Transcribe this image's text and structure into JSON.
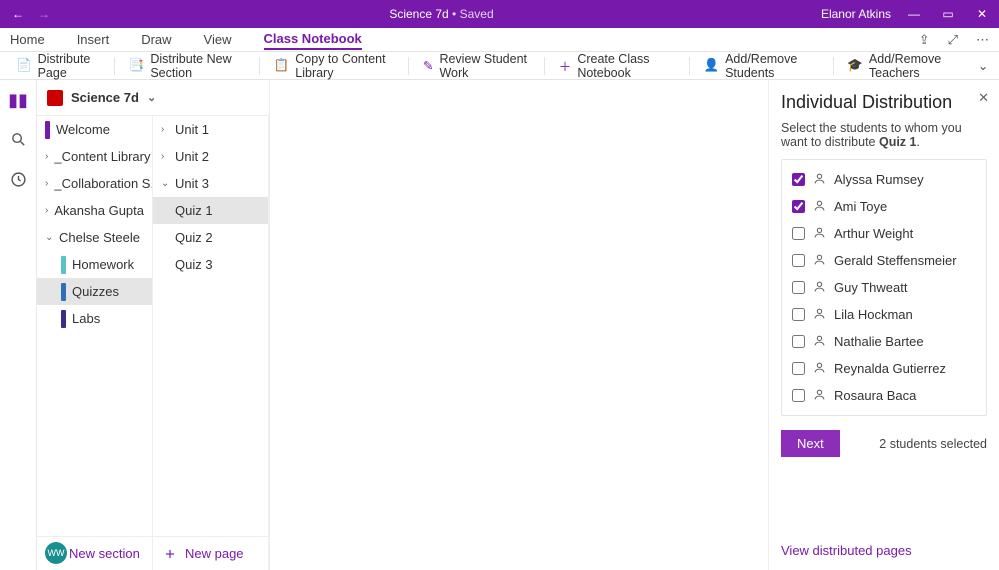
{
  "title": {
    "name": "Science 7d",
    "status": "Saved",
    "user": "Elanor Atkins"
  },
  "menu": {
    "tabs": [
      "Home",
      "Insert",
      "Draw",
      "View",
      "Class Notebook"
    ],
    "active": 4
  },
  "toolbar": [
    "Distribute Page",
    "Distribute New Section",
    "Copy to Content Library",
    "Review Student Work",
    "Create Class Notebook",
    "Add/Remove Students",
    "Add/Remove Teachers"
  ],
  "notebook": "Science 7d",
  "sections": [
    {
      "label": "Welcome",
      "bar": "#7719aa",
      "chev": ""
    },
    {
      "label": "_Content Library",
      "chev": "›"
    },
    {
      "label": "_Collaboration S...",
      "chev": "›"
    },
    {
      "label": "Akansha Gupta",
      "chev": "›"
    },
    {
      "label": "Chelse Steele",
      "chev": "⌄",
      "expanded": true
    },
    {
      "label": "Homework",
      "bar": "#59c2c9",
      "indent": true
    },
    {
      "label": "Quizzes",
      "bar": "#2e6fb5",
      "indent": true,
      "selected": true
    },
    {
      "label": "Labs",
      "bar": "#3b2e87",
      "indent": true
    }
  ],
  "pages_header": [
    {
      "label": "Unit 1",
      "chev": "›"
    },
    {
      "label": "Unit 2",
      "chev": "›"
    },
    {
      "label": "Unit 3",
      "chev": "⌄"
    }
  ],
  "pages": [
    {
      "label": "Quiz 1",
      "selected": true
    },
    {
      "label": "Quiz 2"
    },
    {
      "label": "Quiz 3"
    }
  ],
  "new_section": "New section",
  "new_page": "New page",
  "panel": {
    "title": "Individual Distribution",
    "desc_a": "Select the students to whom you want to distribute ",
    "desc_b": "Quiz 1",
    "desc_c": ".",
    "students": [
      {
        "name": "Alyssa Rumsey",
        "checked": true
      },
      {
        "name": "Ami Toye",
        "checked": true
      },
      {
        "name": "Arthur Weight"
      },
      {
        "name": "Gerald Steffensmeier"
      },
      {
        "name": "Guy Thweatt"
      },
      {
        "name": "Lila Hockman"
      },
      {
        "name": "Nathalie Bartee"
      },
      {
        "name": "Reynalda Gutierrez"
      },
      {
        "name": "Rosaura Baca"
      }
    ],
    "next": "Next",
    "count": "2 students selected",
    "link": "View distributed pages"
  },
  "avatar": "WW"
}
